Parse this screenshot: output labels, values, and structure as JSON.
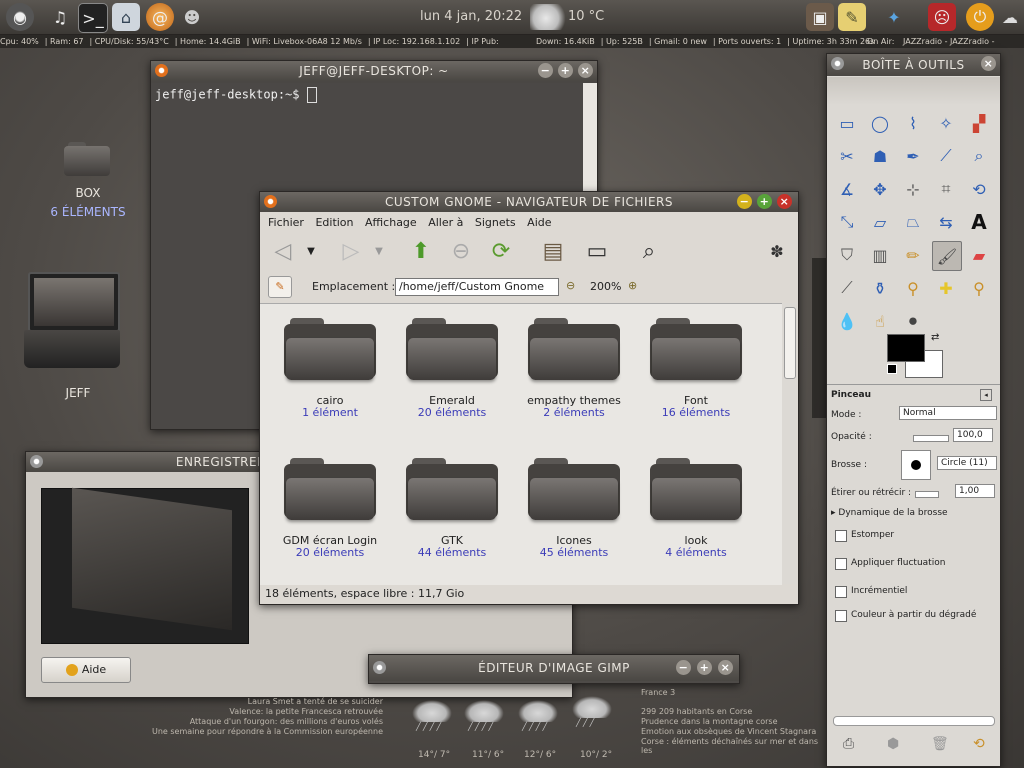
{
  "top_panel": {
    "clock": "lun  4 jan, 20:22",
    "temperature": "10 °C",
    "icons_left": [
      "ubuntu-icon",
      "music-note-icon",
      "terminal-icon",
      "network-icon",
      "shell-icon",
      "gimp-icon"
    ],
    "icons_right": [
      "radio-icon",
      "notes-icon",
      "bird-icon",
      "mask-icon",
      "power-icon"
    ]
  },
  "status_bar": {
    "cpu": "Cpu: 40%",
    "ram": "Ram: 67",
    "cpu_disk": "CPU/Disk: 55/43°C",
    "home": "Home: 14.4GiB",
    "wifi": "WiFi: Livebox-06A8 12 Mb/s",
    "ip_loc": "IP Loc: 192.168.1.102",
    "ip_pub": "IP Pub:",
    "down": "Down: 16.4KiB",
    "up": "Up: 525B",
    "gmail": "Gmail: 0 new",
    "ports": "Ports ouverts: 1",
    "uptime": "Uptime: 3h 33m 26s",
    "on_air_label": "On Air:",
    "on_air_value": "JAZZradio - JAZZradio -"
  },
  "desktop": {
    "box_label": "BOX",
    "box_sub": "6 ÉLÉMENTS",
    "jeff_label": "JEFF"
  },
  "terminal": {
    "title": "JEFF@JEFF-DESKTOP: ~",
    "prompt": "jeff@jeff-desktop:~$"
  },
  "file_manager": {
    "title": "CUSTOM GNOME - NAVIGATEUR DE FICHIERS",
    "menu": [
      "Fichier",
      "Edition",
      "Affichage",
      "Aller à",
      "Signets",
      "Aide"
    ],
    "location_label": "Emplacement :",
    "location_value": "/home/jeff/Custom Gnome",
    "zoom": "200%",
    "status": "18 éléments, espace libre : 11,7 Gio",
    "folders": [
      {
        "name": "cairo",
        "count": "1 élément"
      },
      {
        "name": "Emerald",
        "count": "20 éléments"
      },
      {
        "name": "empathy themes",
        "count": "2 éléments"
      },
      {
        "name": "Font",
        "count": "16 éléments"
      },
      {
        "name": "GDM écran Login",
        "count": "20 éléments"
      },
      {
        "name": "GTK",
        "count": "44 éléments"
      },
      {
        "name": "Icones",
        "count": "45 éléments"
      },
      {
        "name": "look",
        "count": "4 éléments"
      }
    ]
  },
  "recorder": {
    "title": "ENREGISTRER UNE CAPTURE D'ÉCRAN",
    "help_button": "Aide"
  },
  "gimp_bar": {
    "title": "ÉDITEUR D'IMAGE GIMP"
  },
  "toolbox": {
    "title": "BOÎTE À OUTILS",
    "section": "Pinceau",
    "mode_label": "Mode :",
    "mode_value": "Normal",
    "opacity_label": "Opacité :",
    "opacity_value": "100,0",
    "brush_label": "Brosse :",
    "brush_value": "Circle (11)",
    "scale_label": "Étirer ou rétrécir :",
    "scale_value": "1,00",
    "dynamics": "Dynamique de la brosse",
    "options": [
      "Estomper",
      "Appliquer fluctuation",
      "Incrémentiel",
      "Couleur à partir du dégradé"
    ]
  },
  "news": {
    "left": [
      "Laura Smet a tenté de se suicider",
      "Valence: la petite Francesca retrouvée",
      "Attaque d'un fourgon: des millions d'euros volés",
      "Une semaine pour répondre à la Commission européenne"
    ],
    "right_title": "France 3",
    "right": [
      "299 209 habitants en Corse",
      "Prudence dans la montagne corse",
      "Emotion aux obsèques de Vincent Stagnara",
      "Corse : éléments déchaînés sur mer et dans les"
    ],
    "forecast": [
      "14°/ 7°",
      "11°/ 6°",
      "12°/ 6°",
      "10°/ 2°"
    ]
  }
}
